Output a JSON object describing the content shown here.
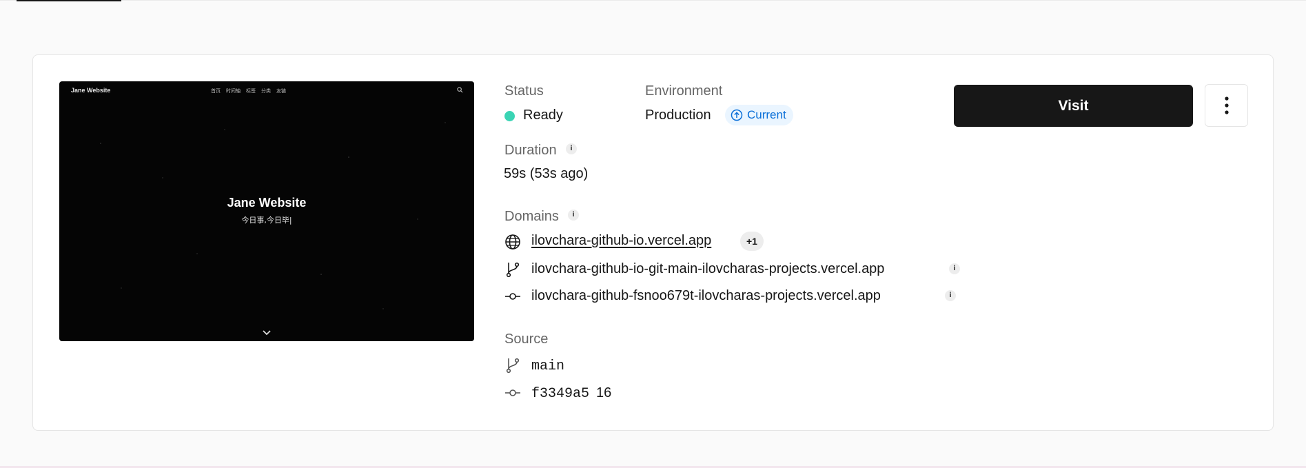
{
  "preview": {
    "brand": "Jane Website",
    "menu": [
      "首页",
      "时间轴",
      "标签",
      "分类",
      "友链"
    ],
    "title": "Jane Website",
    "subtitle": "今日事,今日毕|"
  },
  "status": {
    "label": "Status",
    "value": "Ready",
    "color": "#3ad4b4"
  },
  "environment": {
    "label": "Environment",
    "value": "Production",
    "badge": "Current"
  },
  "duration": {
    "label": "Duration",
    "value": "59s (53s ago)"
  },
  "domains": {
    "label": "Domains",
    "primary": "ilovchara-github-io.vercel.app",
    "extra_count": "+1",
    "branch_domain": "ilovchara-github-io-git-main-ilovcharas-projects.vercel.app",
    "commit_domain": "ilovchara-github-fsnoo679t-ilovcharas-projects.vercel.app"
  },
  "source": {
    "label": "Source",
    "branch": "main",
    "commit": "f3349a5",
    "commit_message": "16"
  },
  "actions": {
    "visit_label": "Visit",
    "more_icon": "vertical-ellipsis-icon"
  },
  "icons": [
    "globe-icon",
    "git-branch-icon",
    "git-commit-icon",
    "info-icon",
    "arrow-up-circle-icon",
    "search-icon",
    "chevron-down-icon"
  ]
}
